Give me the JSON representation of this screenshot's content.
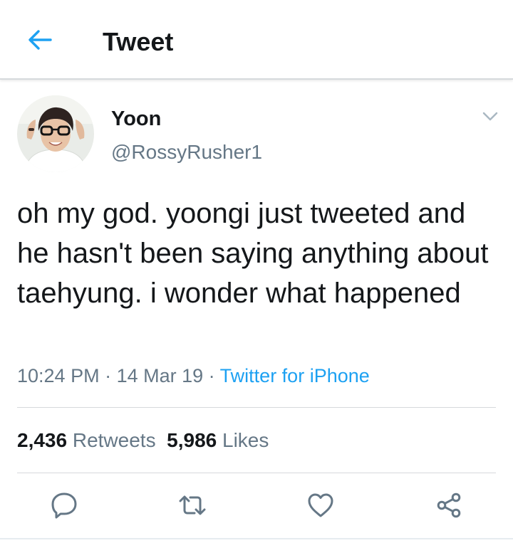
{
  "header": {
    "title": "Tweet",
    "back_icon": "arrow-left-icon"
  },
  "tweet": {
    "author": {
      "display_name": "Yoon",
      "handle": "@RossyRusher1"
    },
    "text": "oh my god. yoongi just tweeted and he hasn't been saying anything about taehyung. i wonder what happened",
    "time": "10:24 PM",
    "date": "14 Mar 19",
    "separator": " · ",
    "source": "Twitter for iPhone",
    "stats": {
      "retweets_count": "2,436",
      "retweets_label": "Retweets",
      "likes_count": "5,986",
      "likes_label": "Likes"
    }
  },
  "actions": [
    {
      "icon": "reply-icon"
    },
    {
      "icon": "retweet-icon"
    },
    {
      "icon": "like-icon"
    },
    {
      "icon": "share-icon"
    }
  ],
  "colors": {
    "accent": "#1da1f2",
    "icon_gray": "#657786",
    "text": "#14171a"
  }
}
